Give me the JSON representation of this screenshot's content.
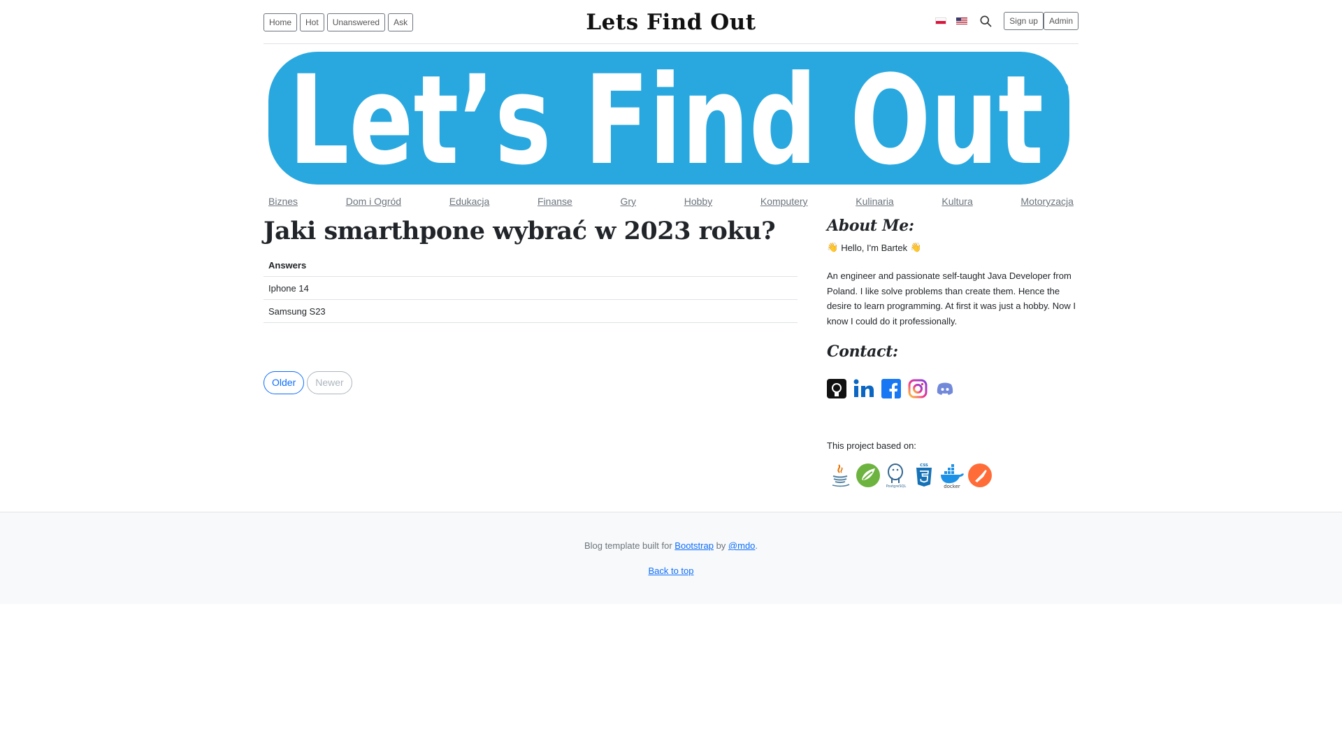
{
  "header": {
    "nav_buttons": [
      "Home",
      "Hot",
      "Unanswered",
      "Ask"
    ],
    "site_title": "Lets Find Out",
    "auth_buttons": [
      "Sign up",
      "Admin"
    ]
  },
  "logo_text": "Let’s Find Out",
  "categories": [
    "Biznes",
    "Dom i Ogród",
    "Edukacja",
    "Finanse",
    "Gry",
    "Hobby",
    "Komputery",
    "Kulinaria",
    "Kultura",
    "Motoryzacja"
  ],
  "question": {
    "title": "Jaki smarthpone wybrać w 2023 roku?",
    "answers_header": "Answers",
    "answers": [
      "Iphone 14",
      "Samsung S23"
    ]
  },
  "pager": {
    "older": "Older",
    "newer": "Newer"
  },
  "sidebar": {
    "about_heading": "About Me:",
    "hello": "Hello, I'm Bartek",
    "about_text": "An engineer and passionate self-taught Java Developer from Poland. I like solve problems than create them. Hence the desire to learn programming. At first it was just a hobby. Now I know I could do it professionally.",
    "contact_heading": "Contact:",
    "socials": [
      "github-icon",
      "linkedin-icon",
      "facebook-icon",
      "instagram-icon",
      "discord-icon"
    ],
    "based_on": "This project based on:",
    "tech": [
      "java-icon",
      "spring-icon",
      "postgresql-icon",
      "css3-icon",
      "docker-icon",
      "postman-icon"
    ]
  },
  "footer": {
    "line1_pre": "Blog template built for ",
    "line1_link1": "Bootstrap",
    "line1_mid": " by ",
    "line1_link2": "@mdo",
    "line1_post": ".",
    "back_to_top": "Back to top"
  },
  "colors": {
    "logo_blue": "#29a8e0",
    "link_blue": "#0d6efd",
    "muted": "#6c757d"
  }
}
